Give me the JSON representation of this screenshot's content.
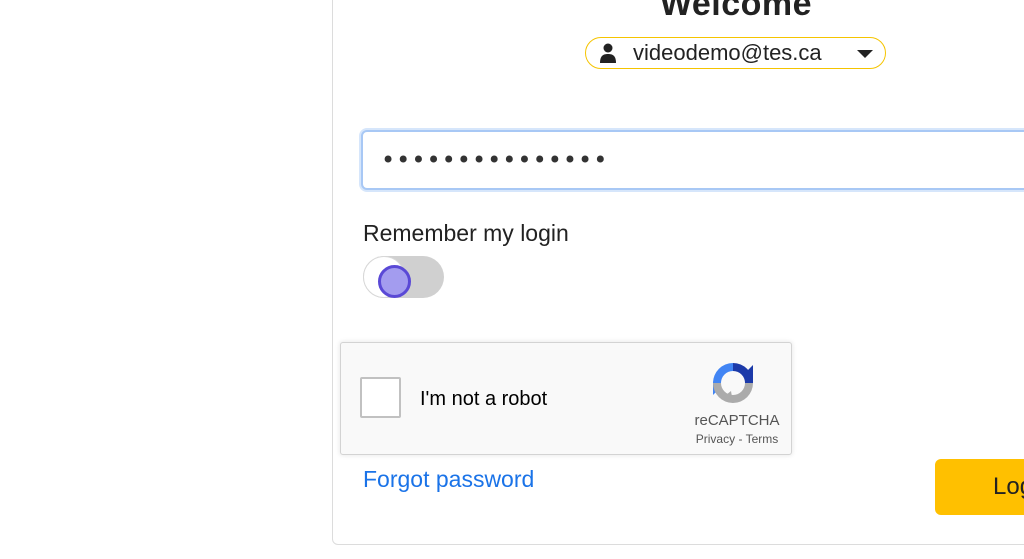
{
  "header": {
    "title": "Welcome"
  },
  "account": {
    "email": "videodemo@tes.ca",
    "icon": "user-icon"
  },
  "password": {
    "value": "•••••••••••••••"
  },
  "remember": {
    "label": "Remember my login",
    "enabled": false
  },
  "recaptcha": {
    "label": "I'm not a robot",
    "brand": "reCAPTCHA",
    "privacy": "Privacy",
    "separator": "-",
    "terms": "Terms"
  },
  "links": {
    "forgot_password": "Forgot password"
  },
  "actions": {
    "login_label": "Login"
  },
  "colors": {
    "accent": "#ffc000",
    "link": "#1a73e8",
    "toggle_knob": "#5a49d6"
  }
}
